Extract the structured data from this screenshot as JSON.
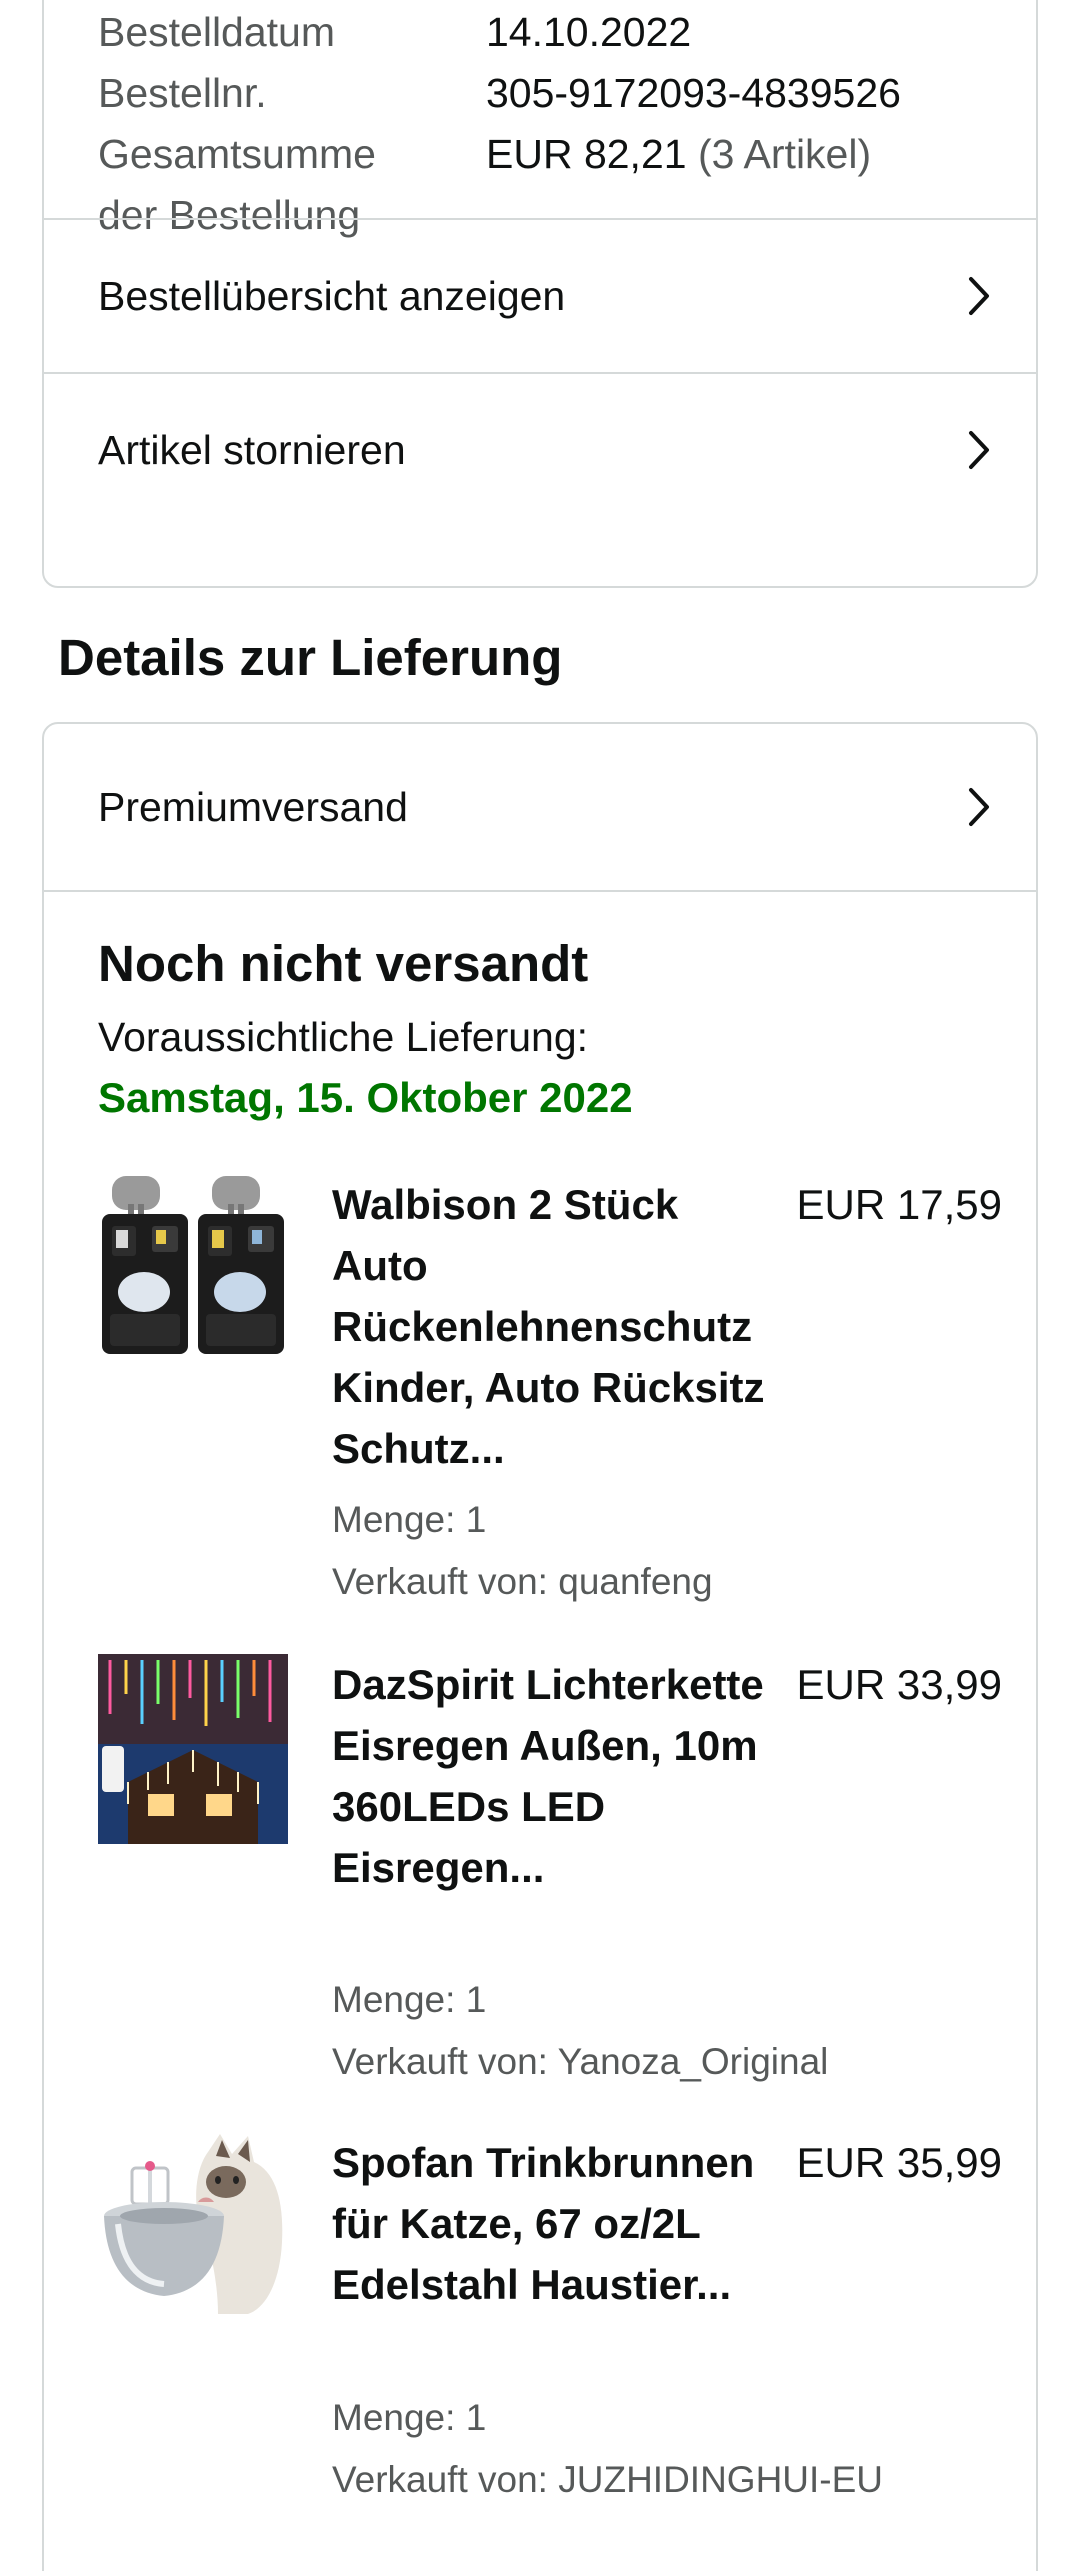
{
  "order": {
    "rows": [
      {
        "label": "Bestelldatum",
        "value": "14.10.2022",
        "extra": ""
      },
      {
        "label": "Bestellnr.",
        "value": "305-9172093-4839526",
        "extra": ""
      },
      {
        "label": "Gesamtsumme",
        "value": "EUR 82,21",
        "extra": "(3 Artikel)"
      },
      {
        "label": "der Bestellung",
        "value": "",
        "extra": ""
      }
    ],
    "overview_label": "Bestellübersicht anzeigen",
    "cancel_label": "Artikel stornieren"
  },
  "delivery": {
    "section_title": "Details zur Lieferung",
    "shipping_method": "Premiumversand",
    "status": "Noch nicht versandt",
    "eta_label": "Voraussichtliche Lieferung:",
    "eta_date": "Samstag, 15. Oktober 2022",
    "eta_color": "#007600",
    "items": [
      {
        "title": "Walbison 2 Stück Auto Rückenlehnenschutz Kinder, Auto Rücksitz Schutz...",
        "price": "EUR 17,59",
        "quantity": "Menge: 1",
        "seller": "Verkauft von: quanfeng",
        "image": "car-seat-organizer-image"
      },
      {
        "title": "DazSpirit Lichterkette Eisregen Außen, 10m 360LEDs LED Eisregen...",
        "price": "EUR 33,99",
        "quantity": "Menge: 1",
        "seller": "Verkauft von: Yanoza_Original",
        "image": "string-lights-image"
      },
      {
        "title": "Spofan Trinkbrunnen für Katze, 67 oz/2L Edelstahl Haustier...",
        "price": "EUR 35,99",
        "quantity": "Menge: 1",
        "seller": "Verkauft von: JUZHIDINGHUI-EU",
        "image": "cat-fountain-image"
      }
    ]
  },
  "icons": {
    "chevron": "chevron-right-icon"
  }
}
